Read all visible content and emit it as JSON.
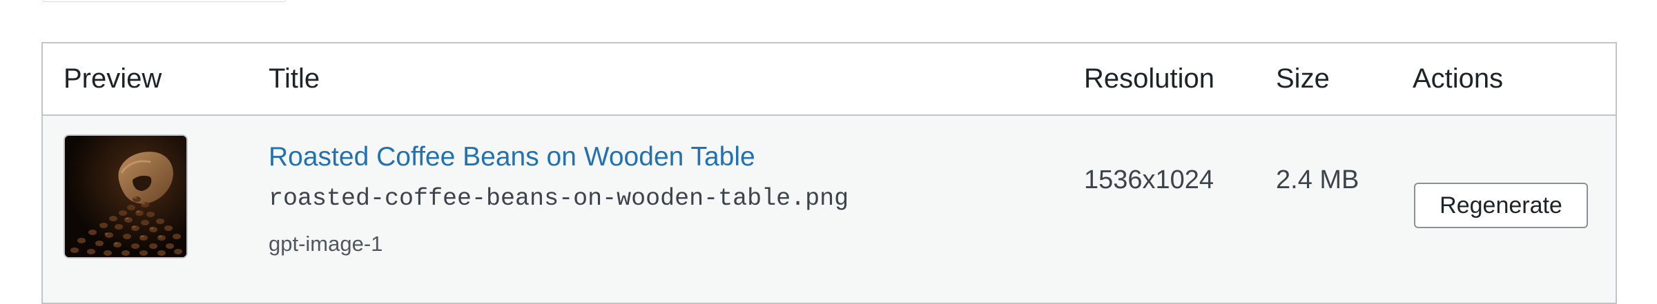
{
  "table": {
    "columns": {
      "preview": "Preview",
      "title": "Title",
      "resolution": "Resolution",
      "size": "Size",
      "actions": "Actions"
    },
    "rows": [
      {
        "thumbnail_icon": "coffee-beans-sack-image",
        "title": "Roasted Coffee Beans on Wooden Table",
        "filename": "roasted-coffee-beans-on-wooden-table.png",
        "model": "gpt-image-1",
        "resolution": "1536x1024",
        "size": "2.4 MB",
        "action_label": "Regenerate"
      }
    ]
  },
  "colors": {
    "link": "#2271b1",
    "border": "#c3c4c7",
    "row_background": "#f6f7f7",
    "header_background": "#ffffff"
  }
}
